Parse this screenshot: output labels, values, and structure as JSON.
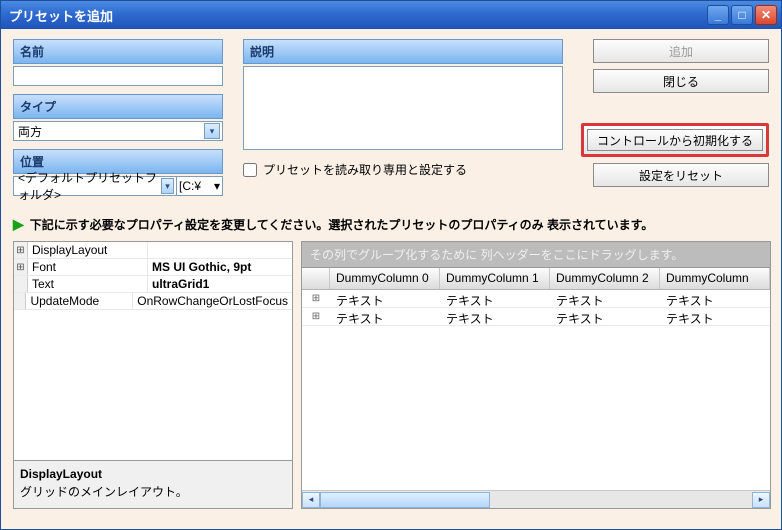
{
  "window": {
    "title": "プリセットを追加"
  },
  "fields": {
    "name_label": "名前",
    "name_value": "",
    "type_label": "タイプ",
    "type_value": "両方",
    "location_label": "位置",
    "location_value": "<デフォルトプリセットフォルダ>",
    "location_path": "[C:¥",
    "desc_label": "説明",
    "desc_value": ""
  },
  "checkbox": {
    "readonly_label": "プリセットを読み取り専用と設定する"
  },
  "buttons": {
    "add": "追加",
    "close": "閉じる",
    "init_from_control": "コントロールから初期化する",
    "reset": "設定をリセット"
  },
  "instruction": "下記に示す必要なプロパティ設定を変更してください。選択されたプリセットのプロパティのみ 表示されています。",
  "props": {
    "rows": [
      {
        "exp": "⊞",
        "name": "DisplayLayout",
        "val": "",
        "bold": false
      },
      {
        "exp": "⊞",
        "name": "Font",
        "val": "MS UI Gothic, 9pt",
        "bold": true
      },
      {
        "exp": "",
        "name": "Text",
        "val": "ultraGrid1",
        "bold": true
      },
      {
        "exp": "",
        "name": "UpdateMode",
        "val": "OnRowChangeOrLostFocus",
        "bold": false
      }
    ],
    "desc_name": "DisplayLayout",
    "desc_text": "グリッドのメインレイアウト。"
  },
  "grid": {
    "groupby_hint": "その列でグループ化するために 列ヘッダーをここにドラッグします。",
    "headers": [
      "DummyColumn 0",
      "DummyColumn 1",
      "DummyColumn 2",
      "DummyColumn"
    ],
    "rows": [
      [
        "テキスト",
        "テキスト",
        "テキスト",
        "テキスト"
      ],
      [
        "テキスト",
        "テキスト",
        "テキスト",
        "テキスト"
      ]
    ]
  }
}
